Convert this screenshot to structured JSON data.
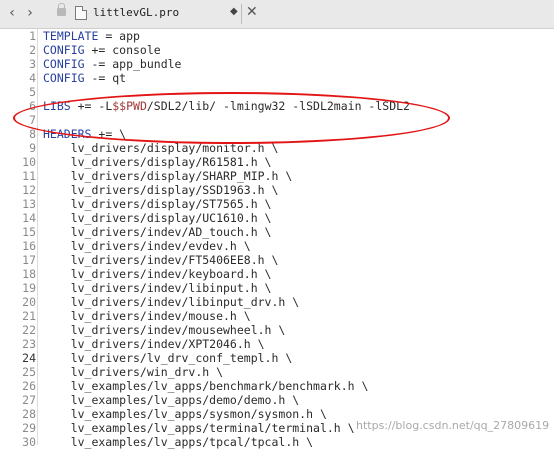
{
  "tab": {
    "back_icon": "chevron-left",
    "forward_icon": "chevron-right",
    "lock_icon": "lock",
    "file_icon": "document",
    "title": "littlevGL.pro",
    "dropdown_glyph": "◆",
    "close_glyph": "✕"
  },
  "editor": {
    "current_line": 24,
    "lines": [
      {
        "n": "1",
        "segments": [
          {
            "t": "TEMPLATE",
            "c": "kw"
          },
          {
            "t": " = app",
            "c": ""
          }
        ]
      },
      {
        "n": "2",
        "segments": [
          {
            "t": "CONFIG",
            "c": "kw"
          },
          {
            "t": " += console",
            "c": ""
          }
        ]
      },
      {
        "n": "3",
        "segments": [
          {
            "t": "CONFIG",
            "c": "kw"
          },
          {
            "t": " -= app_bundle",
            "c": ""
          }
        ]
      },
      {
        "n": "4",
        "segments": [
          {
            "t": "CONFIG",
            "c": "kw"
          },
          {
            "t": " -= qt",
            "c": ""
          }
        ]
      },
      {
        "n": "5",
        "segments": []
      },
      {
        "n": "6",
        "segments": [
          {
            "t": "LIBS",
            "c": "kw"
          },
          {
            "t": " += -L",
            "c": ""
          },
          {
            "t": "$$PWD",
            "c": "var"
          },
          {
            "t": "/SDL2/lib/ -lmingw32 -lSDL2main -lSDL2",
            "c": ""
          }
        ]
      },
      {
        "n": "7",
        "segments": []
      },
      {
        "n": "8",
        "segments": [
          {
            "t": "HEADERS",
            "c": "kw"
          },
          {
            "t": " += \\",
            "c": ""
          }
        ]
      },
      {
        "n": "9",
        "segments": [
          {
            "t": "    lv_drivers/display/monitor.h \\",
            "c": ""
          }
        ]
      },
      {
        "n": "10",
        "segments": [
          {
            "t": "    lv_drivers/display/R61581.h \\",
            "c": ""
          }
        ]
      },
      {
        "n": "11",
        "segments": [
          {
            "t": "    lv_drivers/display/SHARP_MIP.h \\",
            "c": ""
          }
        ]
      },
      {
        "n": "12",
        "segments": [
          {
            "t": "    lv_drivers/display/SSD1963.h \\",
            "c": ""
          }
        ]
      },
      {
        "n": "13",
        "segments": [
          {
            "t": "    lv_drivers/display/ST7565.h \\",
            "c": ""
          }
        ]
      },
      {
        "n": "14",
        "segments": [
          {
            "t": "    lv_drivers/display/UC1610.h \\",
            "c": ""
          }
        ]
      },
      {
        "n": "15",
        "segments": [
          {
            "t": "    lv_drivers/indev/AD_touch.h \\",
            "c": ""
          }
        ]
      },
      {
        "n": "16",
        "segments": [
          {
            "t": "    lv_drivers/indev/evdev.h \\",
            "c": ""
          }
        ]
      },
      {
        "n": "17",
        "segments": [
          {
            "t": "    lv_drivers/indev/FT5406EE8.h \\",
            "c": ""
          }
        ]
      },
      {
        "n": "18",
        "segments": [
          {
            "t": "    lv_drivers/indev/keyboard.h \\",
            "c": ""
          }
        ]
      },
      {
        "n": "19",
        "segments": [
          {
            "t": "    lv_drivers/indev/libinput.h \\",
            "c": ""
          }
        ]
      },
      {
        "n": "20",
        "segments": [
          {
            "t": "    lv_drivers/indev/libinput_drv.h \\",
            "c": ""
          }
        ]
      },
      {
        "n": "21",
        "segments": [
          {
            "t": "    lv_drivers/indev/mouse.h \\",
            "c": ""
          }
        ]
      },
      {
        "n": "22",
        "segments": [
          {
            "t": "    lv_drivers/indev/mousewheel.h \\",
            "c": ""
          }
        ]
      },
      {
        "n": "23",
        "segments": [
          {
            "t": "    lv_drivers/indev/XPT2046.h \\",
            "c": ""
          }
        ]
      },
      {
        "n": "24",
        "segments": [
          {
            "t": "    lv_drivers/lv_drv_conf_templ.h \\",
            "c": ""
          }
        ]
      },
      {
        "n": "25",
        "segments": [
          {
            "t": "    lv_drivers/win_drv.h \\",
            "c": ""
          }
        ]
      },
      {
        "n": "26",
        "segments": [
          {
            "t": "    lv_examples/lv_apps/benchmark/benchmark.h \\",
            "c": ""
          }
        ]
      },
      {
        "n": "27",
        "segments": [
          {
            "t": "    lv_examples/lv_apps/demo/demo.h \\",
            "c": ""
          }
        ]
      },
      {
        "n": "28",
        "segments": [
          {
            "t": "    lv_examples/lv_apps/sysmon/sysmon.h \\",
            "c": ""
          }
        ]
      },
      {
        "n": "29",
        "segments": [
          {
            "t": "    lv_examples/lv_apps/terminal/terminal.h \\",
            "c": ""
          }
        ]
      },
      {
        "n": "30",
        "segments": [
          {
            "t": "    lv_examples/lv_apps/tpcal/tpcal.h \\",
            "c": ""
          }
        ]
      }
    ]
  },
  "annotation_color": "#e21414",
  "watermark": "https://blog.csdn.net/qq_27809619"
}
